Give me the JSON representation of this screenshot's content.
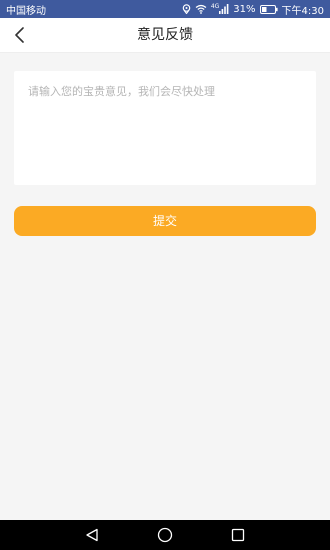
{
  "status_bar": {
    "carrier": "中国移动",
    "network_badge": "4G",
    "battery": "31%",
    "time": "下午4:30"
  },
  "header": {
    "title": "意见反馈"
  },
  "feedback": {
    "placeholder": "请输入您的宝贵意见，我们会尽快处理",
    "value": ""
  },
  "submit": {
    "label": "提交"
  },
  "colors": {
    "status_bar_bg": "#3f5a9e",
    "accent": "#fbaa24",
    "page_bg": "#f5f5f5"
  },
  "icons": {
    "back": "chevron-left-icon",
    "location": "location-icon",
    "wifi": "wifi-icon",
    "signal": "signal-icon",
    "battery": "battery-icon",
    "nav_back": "triangle-back-icon",
    "nav_home": "circle-home-icon",
    "nav_recent": "square-recent-icon"
  }
}
